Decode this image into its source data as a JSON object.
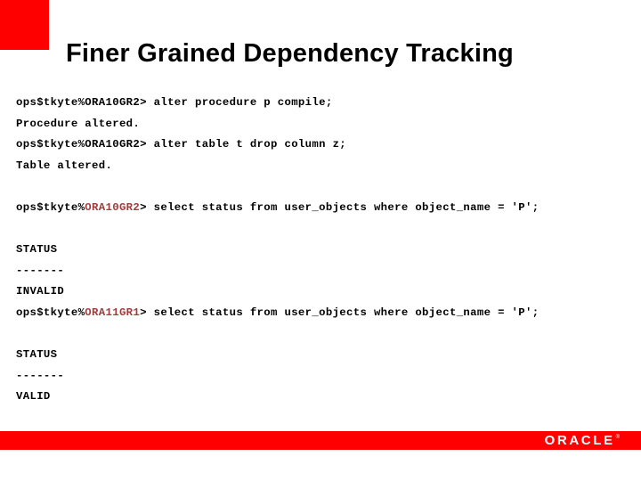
{
  "slide": {
    "title": "Finer Grained Dependency Tracking",
    "accent_color": "#ff0000",
    "footer_color": "#ff0000",
    "db_tag_color": "#a23b3b",
    "text_color": "#000000"
  },
  "footer": {
    "logo_text": "ORACLE",
    "logo_mark": "®"
  },
  "terminal": {
    "lines": [
      {
        "id": "line-1",
        "type": "prompt",
        "prompt_prefix": "ops$tkyte%",
        "db_tag": "ORA10GR2",
        "prompt_suffix": "> ",
        "command": "alter procedure p compile;",
        "tag_highlighted": false,
        "gap_before": false
      },
      {
        "id": "line-2",
        "type": "output",
        "text": "Procedure altered.",
        "gap_before": false
      },
      {
        "id": "line-3",
        "type": "prompt",
        "prompt_prefix": "ops$tkyte%",
        "db_tag": "ORA10GR2",
        "prompt_suffix": "> ",
        "command": "alter table t drop column z;",
        "tag_highlighted": false,
        "gap_before": false
      },
      {
        "id": "line-4",
        "type": "output",
        "text": "Table altered.",
        "gap_before": false
      },
      {
        "id": "line-5",
        "type": "prompt",
        "prompt_prefix": "ops$tkyte%",
        "db_tag": "ORA10GR2",
        "prompt_suffix": "> ",
        "command": "select status from user_objects where object_name = 'P';",
        "tag_highlighted": true,
        "gap_before": true
      },
      {
        "id": "line-6",
        "type": "output",
        "text": "STATUS",
        "gap_before": true
      },
      {
        "id": "line-7",
        "type": "output",
        "text": "-------",
        "gap_before": false
      },
      {
        "id": "line-8",
        "type": "output",
        "text": "INVALID",
        "gap_before": false
      },
      {
        "id": "line-9",
        "type": "prompt",
        "prompt_prefix": "ops$tkyte%",
        "db_tag": "ORA11GR1",
        "prompt_suffix": "> ",
        "command": "select status from user_objects where object_name = 'P';",
        "tag_highlighted": true,
        "gap_before": false
      },
      {
        "id": "line-10",
        "type": "output",
        "text": "STATUS",
        "gap_before": true
      },
      {
        "id": "line-11",
        "type": "output",
        "text": "-------",
        "gap_before": false
      },
      {
        "id": "line-12",
        "type": "output",
        "text": "VALID",
        "gap_before": false
      }
    ]
  }
}
